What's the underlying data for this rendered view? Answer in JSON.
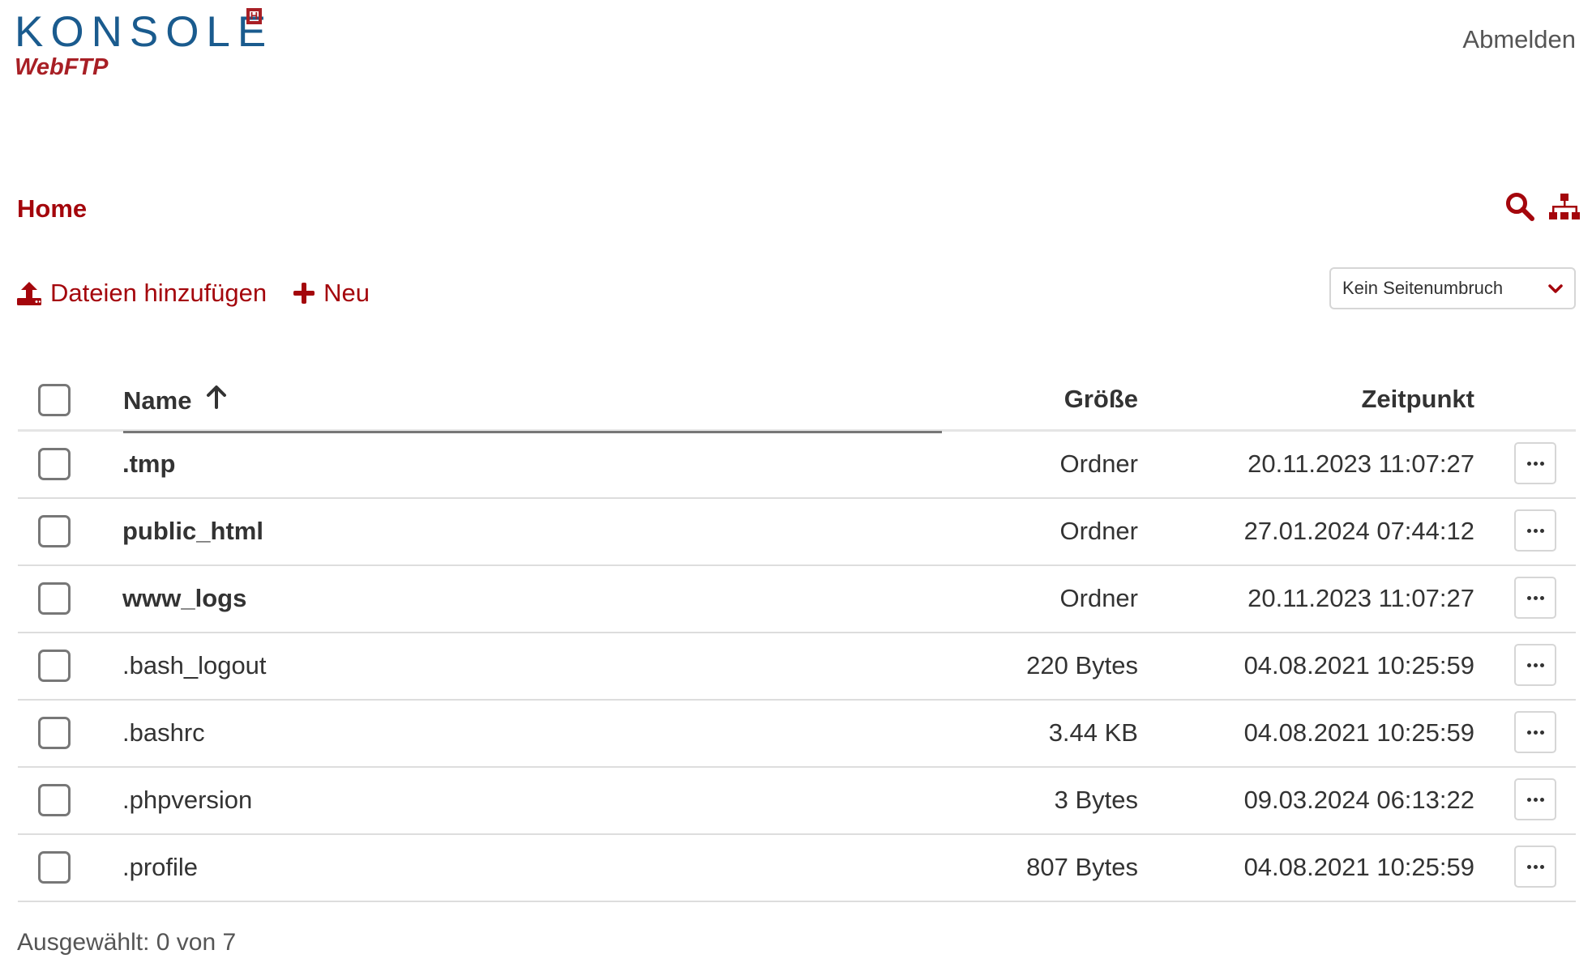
{
  "header": {
    "logo_main": "KONSOLE",
    "logo_sub": "WebFTP",
    "logo_mark": "H",
    "logout_label": "Abmelden"
  },
  "breadcrumb": {
    "home_label": "Home"
  },
  "toolbar": {
    "upload_label": "Dateien hinzufügen",
    "new_label": "Neu",
    "paging_select": "Kein Seitenumbruch"
  },
  "table": {
    "columns": {
      "name": "Name",
      "size": "Größe",
      "time": "Zeitpunkt"
    },
    "rows": [
      {
        "name": ".tmp",
        "size": "Ordner",
        "time": "20.11.2023 11:07:27",
        "is_folder": true
      },
      {
        "name": "public_html",
        "size": "Ordner",
        "time": "27.01.2024 07:44:12",
        "is_folder": true
      },
      {
        "name": "www_logs",
        "size": "Ordner",
        "time": "20.11.2023 11:07:27",
        "is_folder": true
      },
      {
        "name": ".bash_logout",
        "size": "220 Bytes",
        "time": "04.08.2021 10:25:59",
        "is_folder": false
      },
      {
        "name": ".bashrc",
        "size": "3.44 KB",
        "time": "04.08.2021 10:25:59",
        "is_folder": false
      },
      {
        "name": ".phpversion",
        "size": "3 Bytes",
        "time": "09.03.2024 06:13:22",
        "is_folder": false
      },
      {
        "name": ".profile",
        "size": "807 Bytes",
        "time": "04.08.2021 10:25:59",
        "is_folder": false
      }
    ]
  },
  "footer": {
    "selection_status": "Ausgewählt: 0 von 7"
  },
  "icons": {
    "sort": "arrow-up-icon",
    "search": "search-icon",
    "tree": "sitemap-icon",
    "upload": "upload-icon",
    "plus": "plus-icon",
    "dropdown": "chevron-down-icon",
    "more": "ellipsis-icon"
  },
  "colors": {
    "accent": "#a4060c",
    "logo_blue": "#1a5b8e",
    "logo_red": "#a81f25",
    "text": "#333333"
  }
}
